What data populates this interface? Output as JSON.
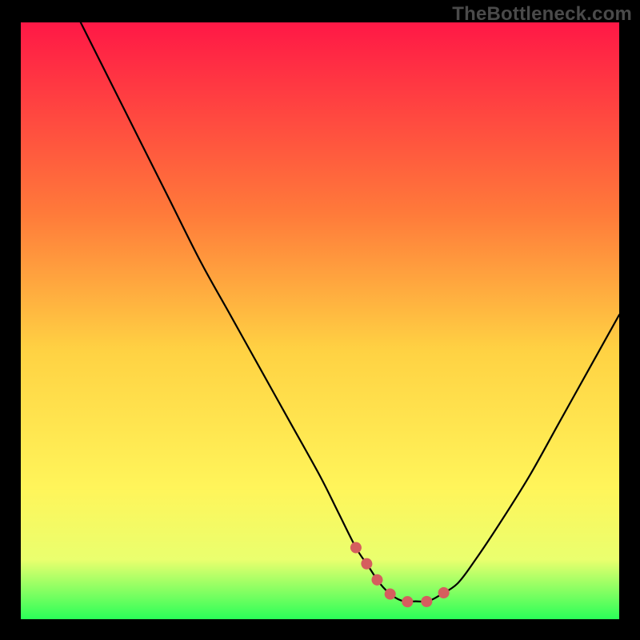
{
  "watermark": "TheBottleneck.com",
  "colors": {
    "frame": "#000000",
    "curve": "#000000",
    "marker": "#d55e5e",
    "gradient_top": "#ff1846",
    "gradient_mid1": "#ff7a3a",
    "gradient_mid2": "#ffd243",
    "gradient_mid3": "#fff55a",
    "gradient_mid4": "#eaff6e",
    "gradient_bottom": "#2aff58"
  },
  "chart_data": {
    "type": "line",
    "title": "",
    "xlabel": "",
    "ylabel": "",
    "xlim": [
      0,
      100
    ],
    "ylim": [
      0,
      100
    ],
    "series": [
      {
        "name": "bottleneck-curve",
        "x": [
          10,
          15,
          20,
          25,
          30,
          35,
          40,
          45,
          50,
          53,
          56,
          58,
          60,
          62,
          64,
          66,
          68,
          70,
          73,
          76,
          80,
          85,
          90,
          95,
          100
        ],
        "y": [
          100,
          90,
          80,
          70,
          60,
          51,
          42,
          33,
          24,
          18,
          12,
          9,
          6,
          4,
          3,
          3,
          3,
          4,
          6,
          10,
          16,
          24,
          33,
          42,
          51
        ]
      }
    ],
    "markers": {
      "name": "highlight-range",
      "x": [
        56,
        58,
        60,
        62,
        64,
        66,
        68,
        70,
        73
      ],
      "y": [
        12,
        9,
        6,
        4,
        3,
        3,
        3,
        4,
        6
      ]
    }
  }
}
